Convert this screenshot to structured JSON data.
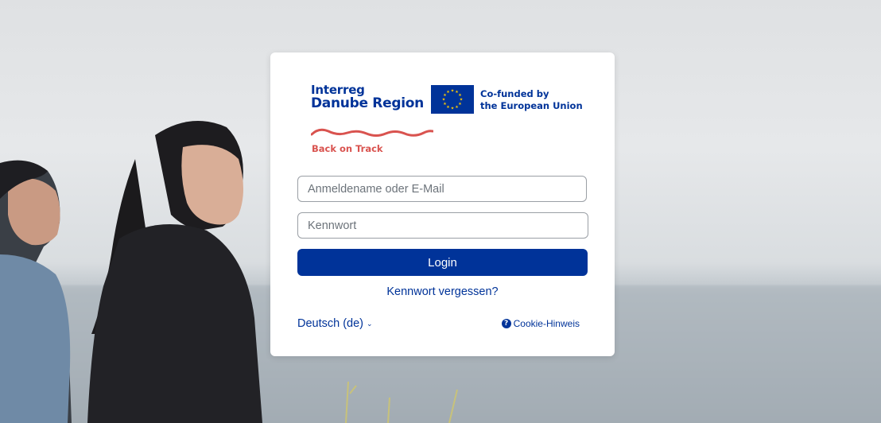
{
  "branding": {
    "interreg_line1": "Interreg",
    "interreg_line2": "Danube Region",
    "eu_line1": "Co-funded by",
    "eu_line2": "the European Union",
    "project_name": "Back on Track",
    "brand_color": "#003399",
    "accent_color": "#d9534f"
  },
  "form": {
    "username_placeholder": "Anmeldename oder E-Mail",
    "password_placeholder": "Kennwort",
    "login_label": "Login",
    "forgot_label": "Kennwort vergessen?"
  },
  "footer": {
    "language_label": "Deutsch (de)",
    "language_icon": "chevron-down-icon",
    "cookie_label": "Cookie-Hinweis",
    "cookie_icon": "question-circle-icon"
  },
  "background": {
    "image": "photo-two-women-by-the-sea"
  }
}
